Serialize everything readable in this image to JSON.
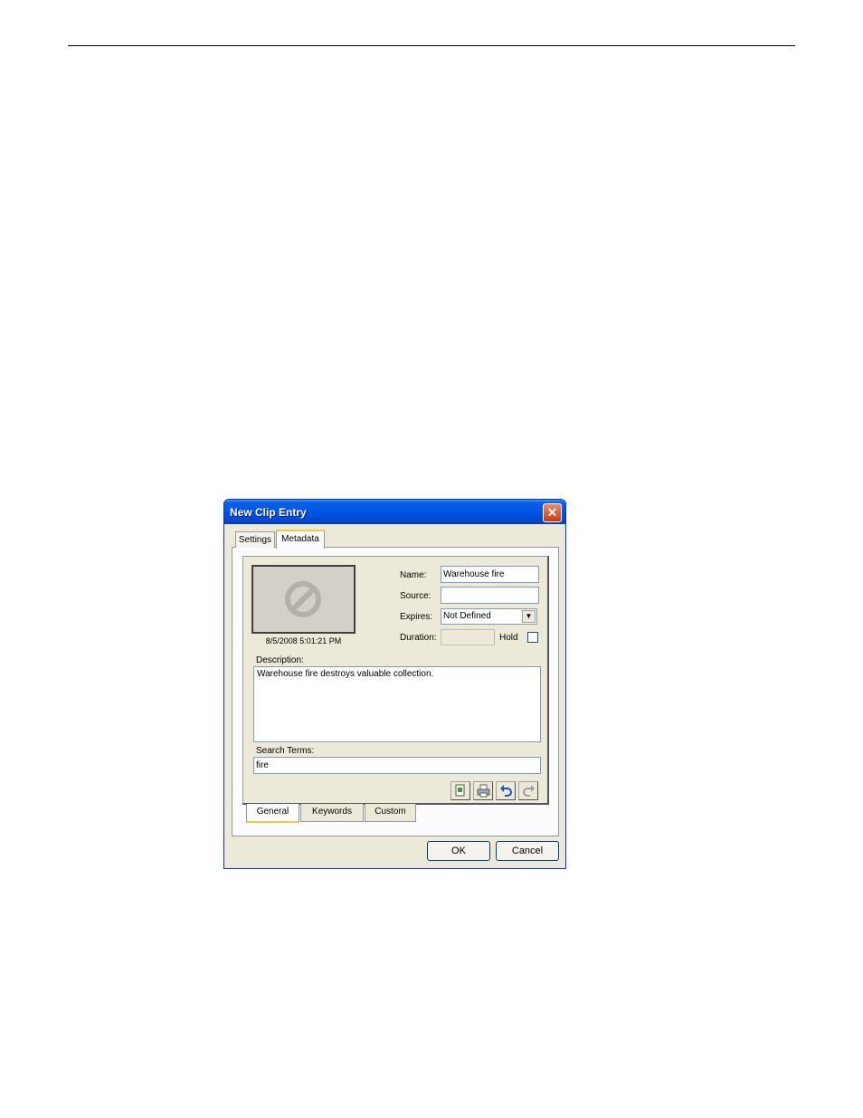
{
  "dialog": {
    "title": "New Clip Entry",
    "close_glyph": "✕"
  },
  "top_tabs": [
    {
      "label": "Settings",
      "active": false
    },
    {
      "label": "Metadata",
      "active": true
    }
  ],
  "thumbnail": {
    "icon": "no-video-icon",
    "timestamp": "8/5/2008 5:01:21 PM"
  },
  "form": {
    "name_label": "Name:",
    "name_value": "Warehouse fire",
    "source_label": "Source:",
    "source_value": "",
    "expires_label": "Expires:",
    "expires_value": "Not Defined",
    "duration_label": "Duration:",
    "duration_value": "",
    "hold_label": "Hold",
    "hold_checked": false
  },
  "description": {
    "label": "Description:",
    "value": "Warehouse fire destroys valuable collection."
  },
  "search_terms": {
    "label": "Search Terms:",
    "value": "fire"
  },
  "toolbar": {
    "icons": [
      "copy-icon",
      "print-icon",
      "undo-icon",
      "redo-icon"
    ]
  },
  "bottom_tabs": [
    {
      "label": "General",
      "active": true
    },
    {
      "label": "Keywords",
      "active": false
    },
    {
      "label": "Custom",
      "active": false
    }
  ],
  "buttons": {
    "ok_label": "OK",
    "cancel_label": "Cancel"
  },
  "colors": {
    "titlebar": "#0055e5",
    "dialog_bg": "#ece9d8",
    "field_border": "#7f9db9",
    "tab_highlight": "#ffc83c"
  }
}
